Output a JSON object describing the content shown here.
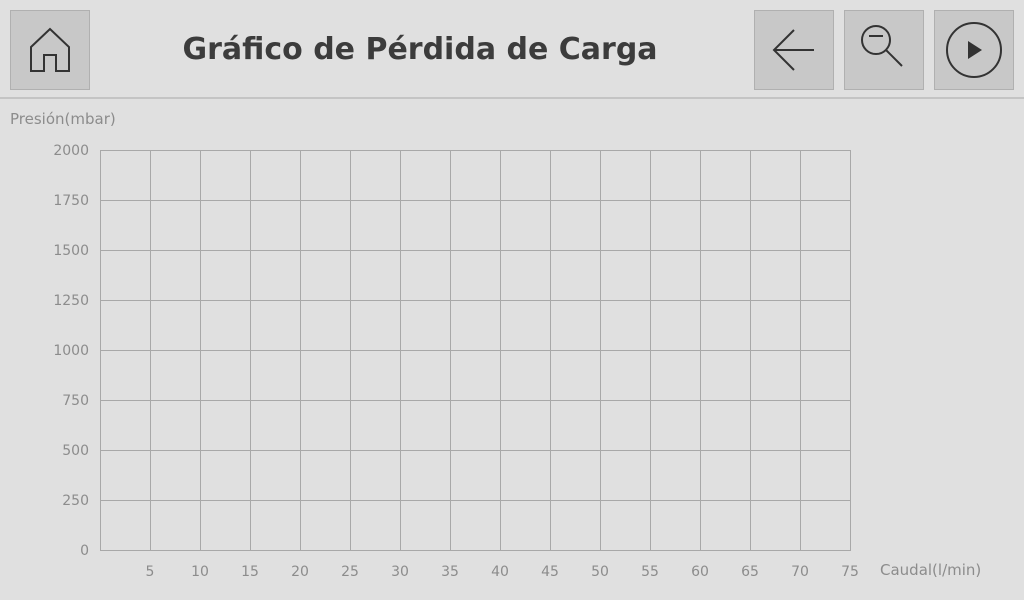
{
  "header": {
    "title": "Gráfico de Pérdida de Carga",
    "buttons": {
      "home": "home-icon",
      "back": "arrow-left-icon",
      "zoom_out": "zoom-out-icon",
      "play": "play-icon"
    }
  },
  "colors": {
    "background": "#e0e0e0",
    "button": "#c8c8c8",
    "grid": "#a8a8a8",
    "text_muted": "#8c8c8c",
    "title": "#3c3c3c"
  },
  "chart_data": {
    "type": "line",
    "title": "",
    "xlabel": "Caudal(l/min)",
    "ylabel": "Presión(mbar)",
    "xlim": [
      0,
      75
    ],
    "ylim": [
      0,
      2000
    ],
    "x_ticks": [
      5,
      10,
      15,
      20,
      25,
      30,
      35,
      40,
      45,
      50,
      55,
      60,
      65,
      70,
      75
    ],
    "y_ticks": [
      0,
      250,
      500,
      750,
      1000,
      1250,
      1500,
      1750,
      2000
    ],
    "grid": true,
    "series": []
  }
}
